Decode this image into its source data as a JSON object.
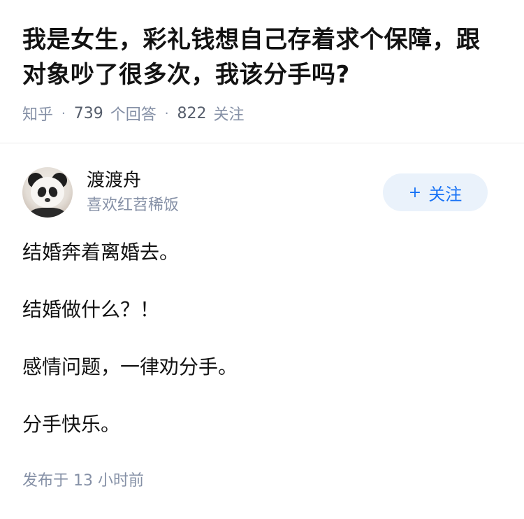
{
  "question": {
    "title": "我是女生，彩礼钱想自己存着求个保障，跟对象吵了很多次，我该分手吗?",
    "source": "知乎",
    "answers_count": "739",
    "answers_label": "个回答",
    "followers_count": "822",
    "followers_label": "关注"
  },
  "author": {
    "name": "渡渡舟",
    "bio": "喜欢红苕稀饭",
    "avatar_icon": "panda-avatar",
    "follow_label": "关注",
    "follow_icon": "plus-icon"
  },
  "answer": {
    "paragraphs": [
      "结婚奔着离婚去。",
      "结婚做什么？！",
      "感情问题，一律劝分手。",
      "分手快乐。"
    ]
  },
  "footer": {
    "published_prefix": "发布于",
    "published_time": "13 小时前"
  },
  "colors": {
    "title": "#121212",
    "meta": "#8590a6",
    "accent": "#1772f6",
    "follow_bg": "#eaf2fb"
  }
}
